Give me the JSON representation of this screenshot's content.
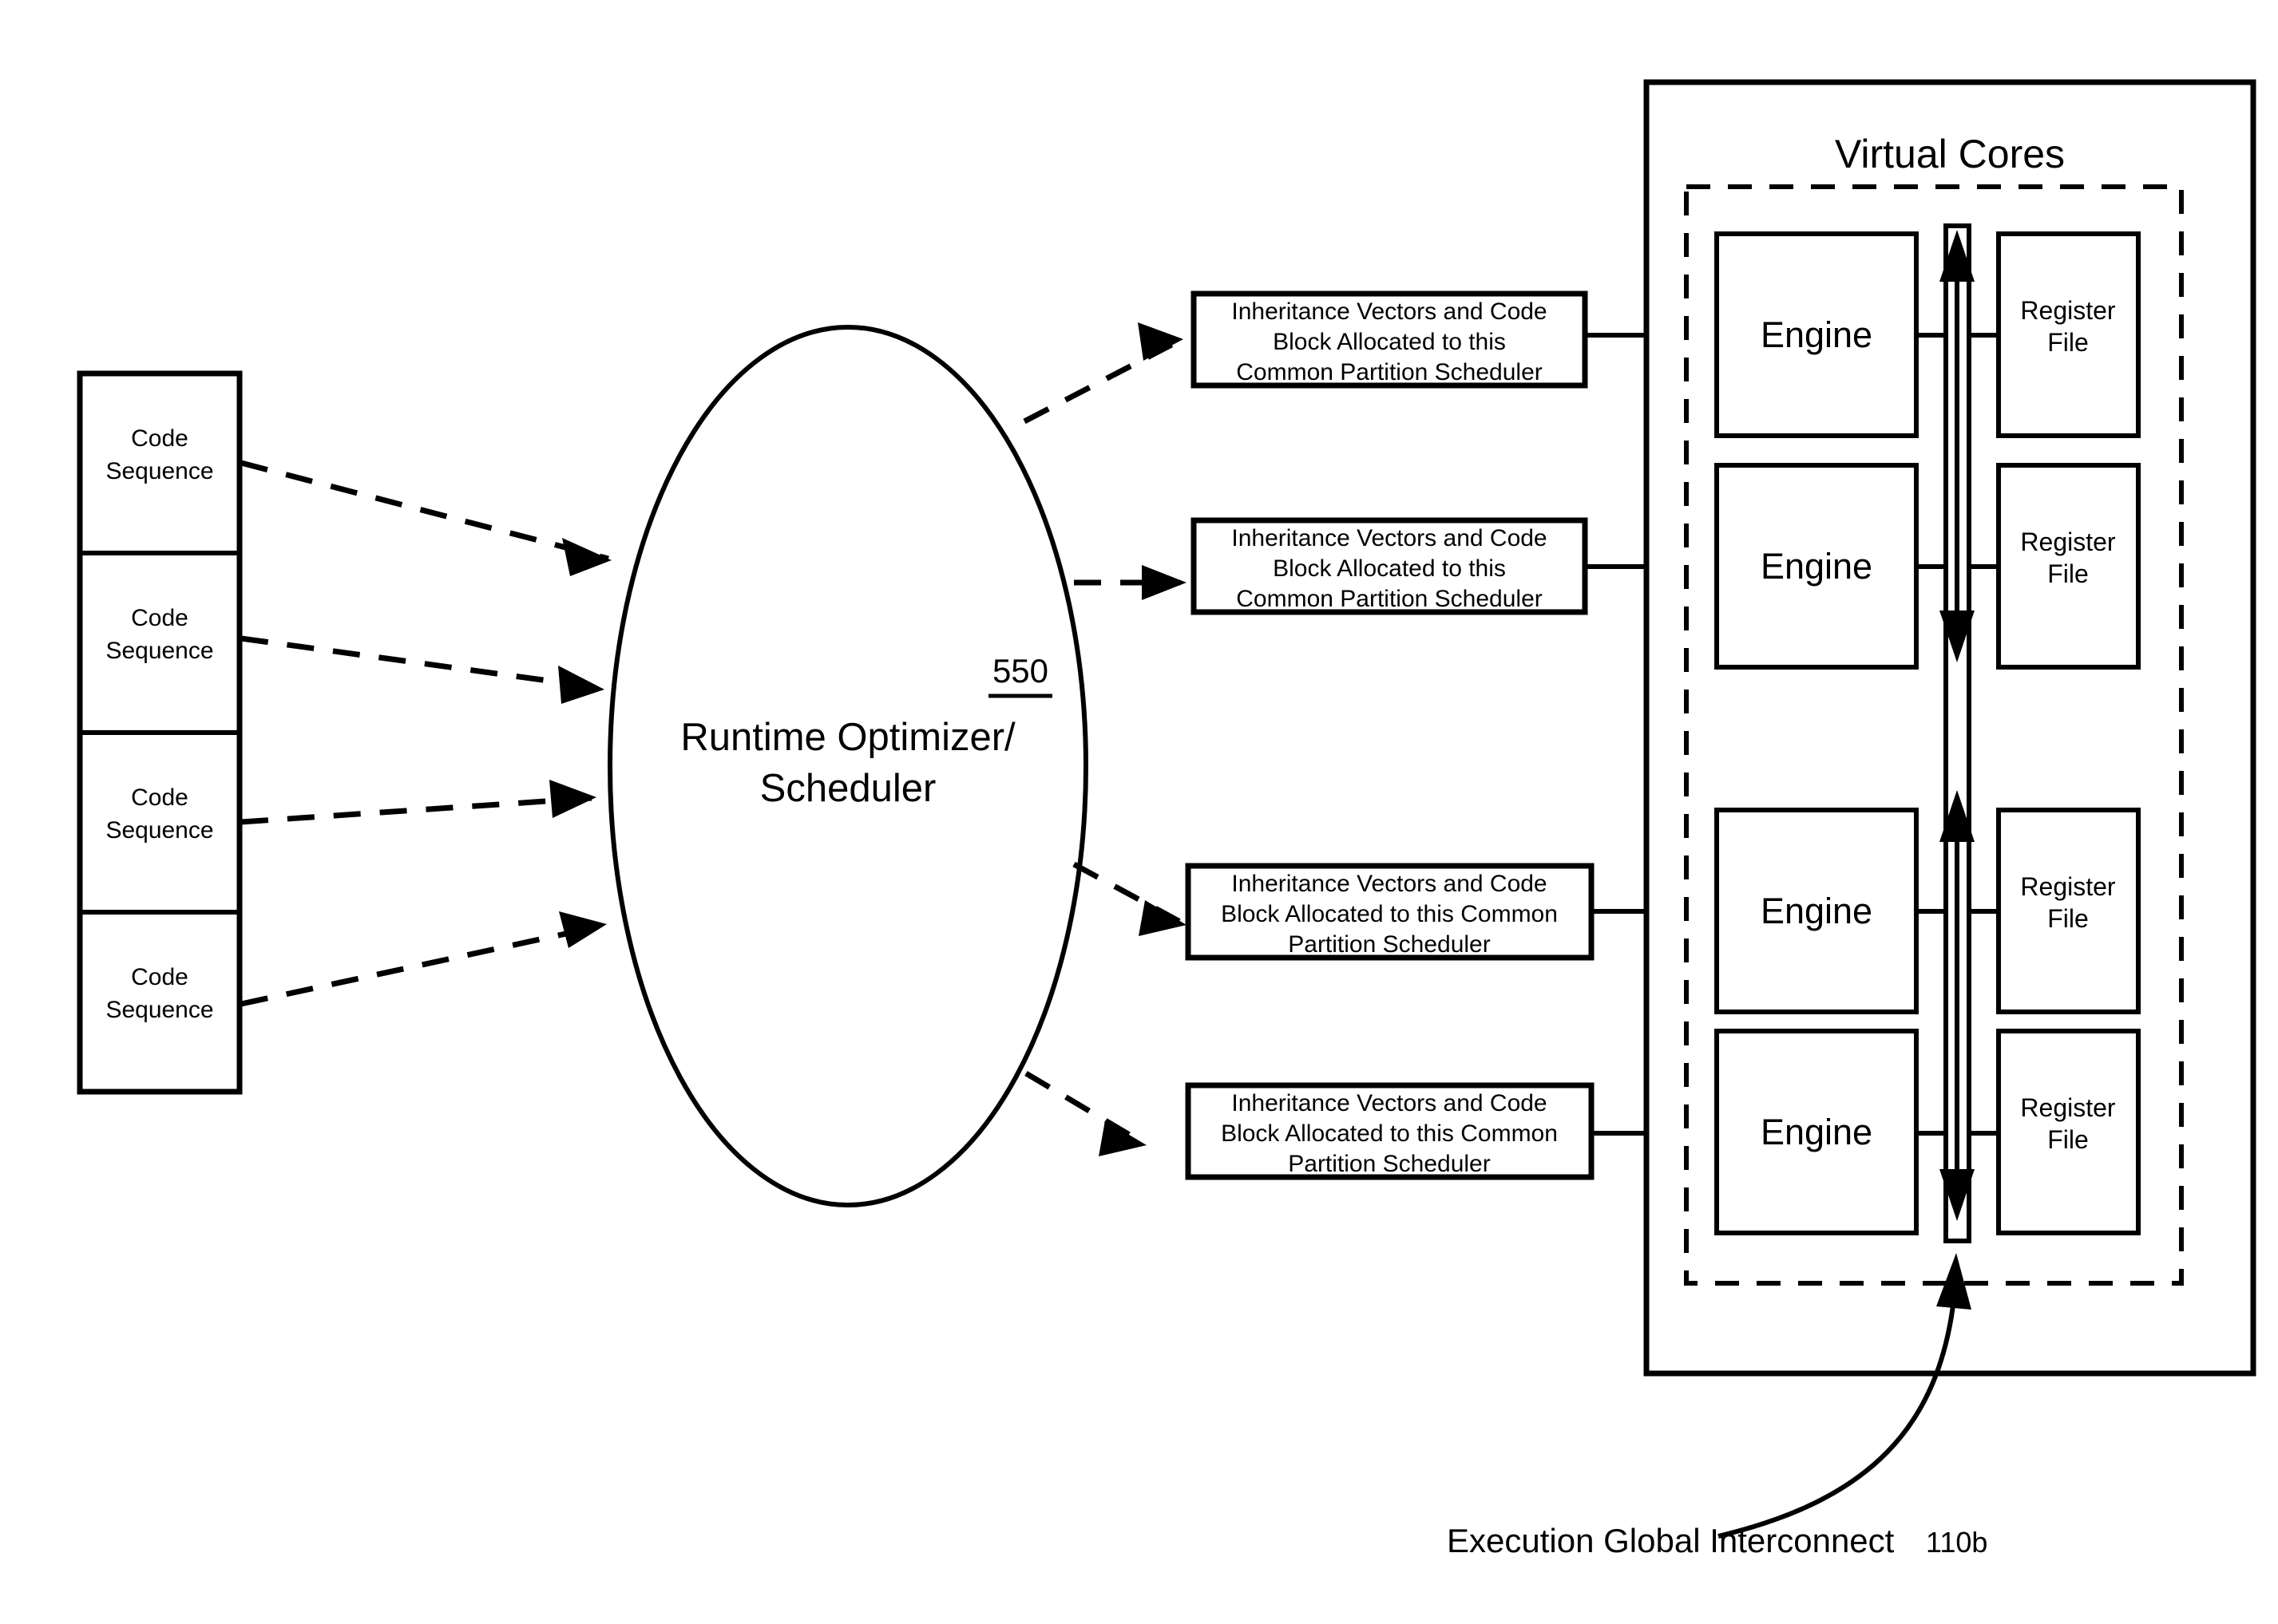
{
  "figure": {
    "code_sequences": {
      "label": "Code Sequence",
      "count": 4,
      "items": [
        {
          "line1": "Code",
          "line2": "Sequence"
        },
        {
          "line1": "Code",
          "line2": "Sequence"
        },
        {
          "line1": "Code",
          "line2": "Sequence"
        },
        {
          "line1": "Code",
          "line2": "Sequence"
        }
      ]
    },
    "optimizer": {
      "line1": "Runtime Optimizer/",
      "line2": "Scheduler",
      "reference": "550"
    },
    "partition_boxes": [
      {
        "line1": "Inheritance Vectors and Code",
        "line2": "Block Allocated to this",
        "line3": "Common Partition Scheduler"
      },
      {
        "line1": "Inheritance Vectors and Code",
        "line2": "Block Allocated to this",
        "line3": "Common Partition Scheduler"
      },
      {
        "line1": "Inheritance Vectors and Code",
        "line2": "Block Allocated to this Common",
        "line3": "Partition Scheduler"
      },
      {
        "line1": "Inheritance Vectors and Code",
        "line2": "Block Allocated to this Common",
        "line3": "Partition Scheduler"
      }
    ],
    "virtual_cores": {
      "title": "Virtual Cores",
      "rows": [
        {
          "engine": "Engine",
          "register_file_line1": "Register",
          "register_file_line2": "File"
        },
        {
          "engine": "Engine",
          "register_file_line1": "Register",
          "register_file_line2": "File"
        },
        {
          "engine": "Engine",
          "register_file_line1": "Register",
          "register_file_line2": "File"
        },
        {
          "engine": "Engine",
          "register_file_line1": "Register",
          "register_file_line2": "File"
        }
      ]
    },
    "interconnect": {
      "label": "Execution Global Interconnect",
      "reference": "110b"
    },
    "colors": {
      "line": "#000000",
      "background": "#ffffff"
    }
  }
}
